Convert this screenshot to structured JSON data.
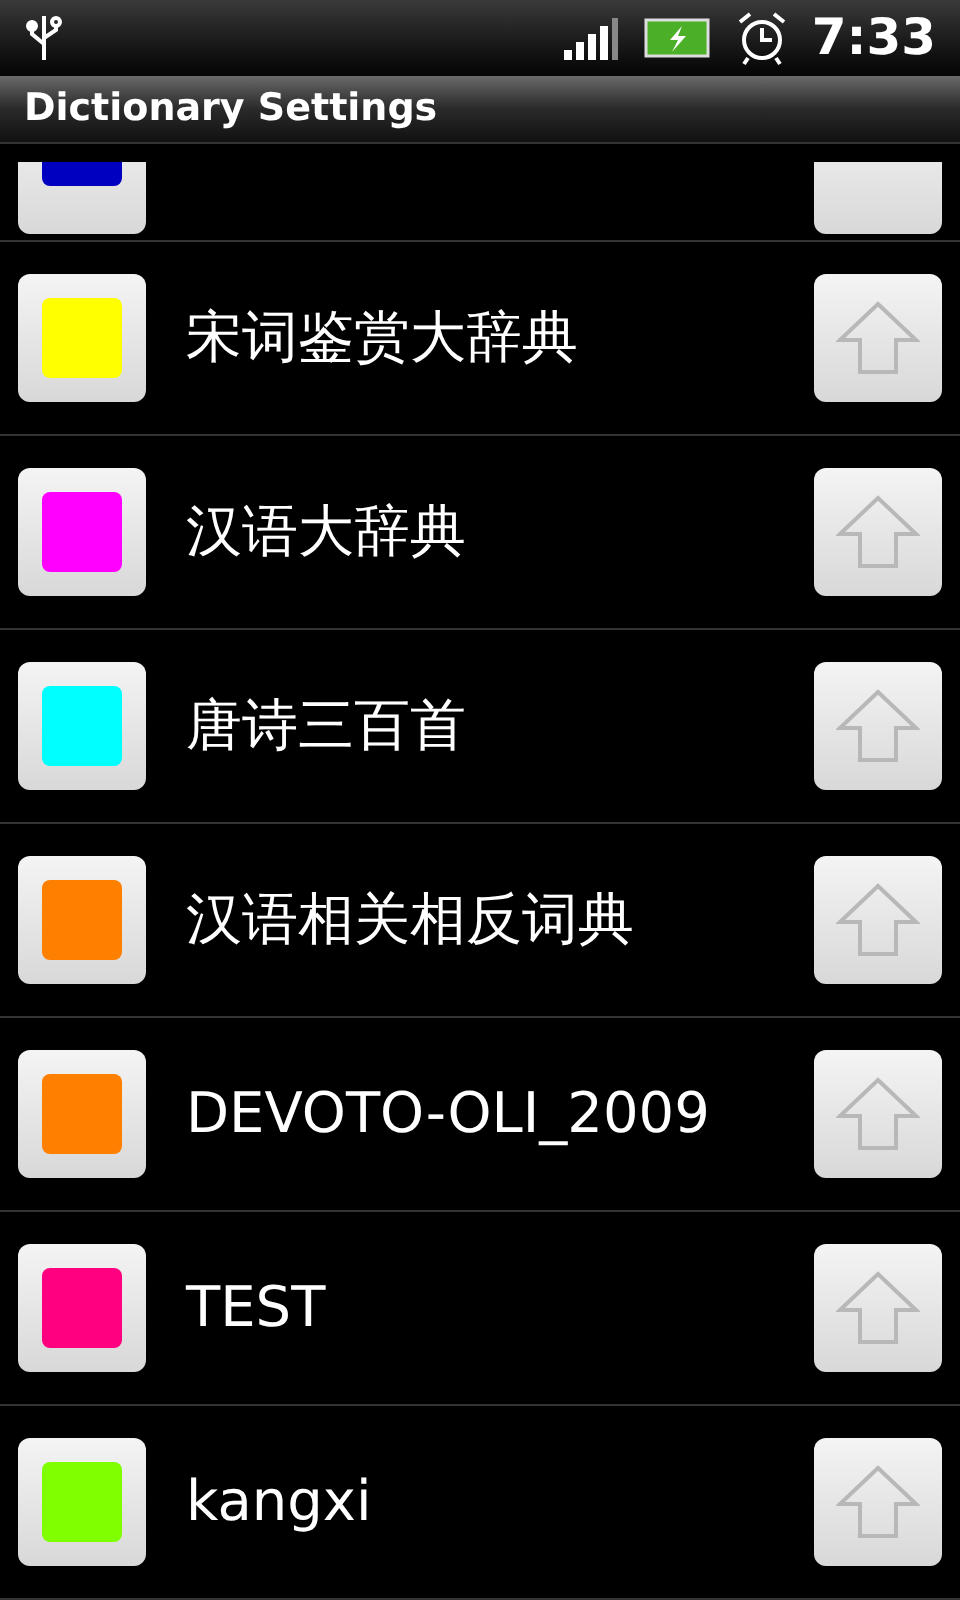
{
  "status_bar": {
    "time": "7:33"
  },
  "window": {
    "title": "Dictionary Settings"
  },
  "dictionaries": [
    {
      "kind": "partial",
      "color": "#0000c0"
    },
    {
      "kind": "full",
      "name": "宋词鉴赏大辞典",
      "color": "#ffff00"
    },
    {
      "kind": "full",
      "name": "汉语大辞典",
      "color": "#ff00ff"
    },
    {
      "kind": "full",
      "name": "唐诗三百首",
      "color": "#00ffff"
    },
    {
      "kind": "full",
      "name": "汉语相关相反词典",
      "color": "#ff8000"
    },
    {
      "kind": "full",
      "name": "DEVOTO-OLI_2009",
      "color": "#ff8000"
    },
    {
      "kind": "full",
      "name": "TEST",
      "color": "#ff0080"
    },
    {
      "kind": "full",
      "name": "kangxi",
      "color": "#80ff00"
    }
  ]
}
